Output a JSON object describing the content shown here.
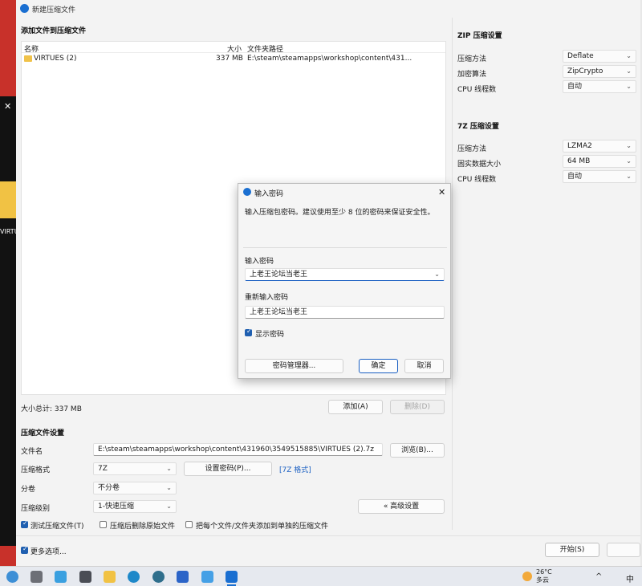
{
  "window": {
    "title": "新建压缩文件"
  },
  "file_section": {
    "title": "添加文件到压缩文件",
    "columns": [
      "名称",
      "大小",
      "文件夹路径"
    ],
    "rows": [
      {
        "name": "VIRTUES (2)",
        "size": "337 MB",
        "path": "E:\\steam\\steamapps\\workshop\\content\\431..."
      }
    ],
    "total": "大小总计: 337 MB",
    "add_button": "添加(A)",
    "remove_button": "删除(D)"
  },
  "settings": {
    "title": "压缩文件设置",
    "filename_label": "文件名",
    "filename_value": "E:\\steam\\steamapps\\workshop\\content\\431960\\3549515885\\VIRTUES (2).7z",
    "browse_button": "浏览(B)...",
    "format_label": "压缩格式",
    "format_value": "7Z",
    "set_password_button": "设置密码(P)...",
    "format_link": "[7Z 格式]",
    "split_label": "分卷",
    "split_value": "不分卷",
    "level_label": "压缩级别",
    "level_value": "1-快速压缩",
    "advanced_button": "« 高级设置",
    "test_archive": "测试压缩文件(T)",
    "delete_after": "压缩后删除原始文件",
    "separate_archives": "把每个文件/文件夹添加到单独的压缩文件",
    "more_options": "更多选项...",
    "start_button": "开始(S)"
  },
  "zip_settings": {
    "title": "ZIP 压缩设置",
    "method_label": "压缩方法",
    "method_value": "Deflate",
    "encrypt_label": "加密算法",
    "encrypt_value": "ZipCrypto",
    "threads_label": "CPU 线程数",
    "threads_value": "自动"
  },
  "sevenz_settings": {
    "title": "7Z 压缩设置",
    "method_label": "压缩方法",
    "method_value": "LZMA2",
    "solid_label": "固实数据大小",
    "solid_value": "64 MB",
    "threads_label": "CPU 线程数",
    "threads_value": "自动"
  },
  "dialog": {
    "title": "输入密码",
    "description": "输入压缩包密码。建议使用至少 8 位的密码来保证安全性。",
    "password_label": "输入密码",
    "password_value": "上老王论坛当老王",
    "repeat_label": "重新输入密码",
    "repeat_value": "上老王论坛当老王",
    "show_password": "显示密码",
    "manager_button": "密码管理器...",
    "ok_button": "确定",
    "cancel_button": "取消",
    "close_glyph": "✕"
  },
  "desktop": {
    "folder_label": "VIRTU"
  },
  "taskbar": {
    "temperature": "26°C",
    "weather": "多云",
    "chevron": "^",
    "ime": "中"
  },
  "colors": {
    "accent": "#1a6fd1",
    "folder": "#f0c24a",
    "link": "#1a5fc2"
  }
}
